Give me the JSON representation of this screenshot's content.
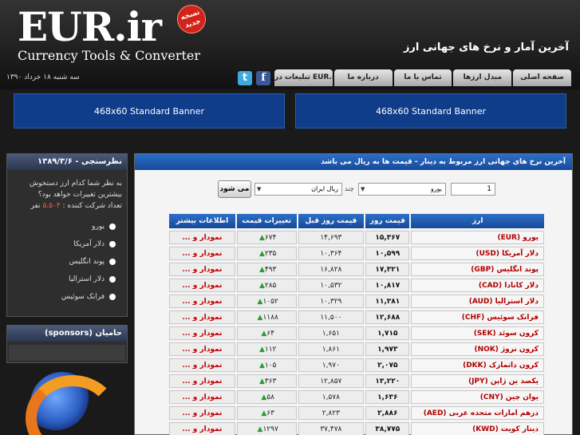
{
  "header": {
    "logo": "EUR.ir",
    "badge": "نسخه جدید",
    "tagline": "Currency Tools & Converter",
    "title": "آخرین آمار و نرخ های جهانی ارز",
    "date": "سه شنبه ۱۸ خرداد ۱۳۹۰"
  },
  "nav": [
    {
      "label": "صفحه اصلی"
    },
    {
      "label": "مبدل ارزها"
    },
    {
      "label": "تماس با ما"
    },
    {
      "label": "درباره ما"
    },
    {
      "label": "تبلیغات در EUR.ir"
    }
  ],
  "banners": {
    "left": "468x60 Standard Banner",
    "right": "468x60 Standard Banner"
  },
  "poll": {
    "title": "نظرسنجی - ۱۳۸۹/۳/۶",
    "question": "به نظر شما کدام ارز دستخوش بیشترین تغییرات خواهد بود؟",
    "participants_label": "تعداد شرکت کننده :",
    "participants_count": "۵.۵۰۳",
    "participants_unit": "نفر",
    "options": [
      {
        "label": "یورو"
      },
      {
        "label": "دلار آمریکا"
      },
      {
        "label": "پوند انگلیس"
      },
      {
        "label": "دلار استرالیا"
      },
      {
        "label": "فرانک سوئیس"
      }
    ]
  },
  "sponsors": {
    "title": "حامیان (sponsors)"
  },
  "main": {
    "header": "آخرین نرخ های جهانی ارز مربوط به دینار - قیمت ها به ریال می باشد",
    "converter": {
      "amount": "1",
      "from": "یورو",
      "chand": "چند",
      "to": "ریال ایران",
      "submit": "می شود"
    },
    "table": {
      "headers": [
        "ارز",
        "قیمت روز",
        "قیمت روز قبل",
        "تغییرات قیمت",
        "اطلاعات بیشتر"
      ],
      "rows": [
        {
          "name": "یورو (EUR)",
          "today": "۱۵,۳۶۷",
          "prev": "۱۴,۶۹۳",
          "change": "۶۷۴",
          "more": "نمودار و ..."
        },
        {
          "name": "دلار آمریکا (USD)",
          "today": "۱۰,۵۹۹",
          "prev": "۱۰,۳۶۴",
          "change": "۲۳۵",
          "more": "نمودار و ..."
        },
        {
          "name": "پوند انگلیس (GBP)",
          "today": "۱۷,۳۲۱",
          "prev": "۱۶,۸۲۸",
          "change": "۴۹۳",
          "more": "نمودار و ..."
        },
        {
          "name": "دلار کانادا (CAD)",
          "today": "۱۰,۸۱۷",
          "prev": "۱۰,۵۳۲",
          "change": "۲۸۵",
          "more": "نمودار و ..."
        },
        {
          "name": "دلار استرالیا (AUD)",
          "today": "۱۱,۳۸۱",
          "prev": "۱۰,۳۲۹",
          "change": "۱۰۵۲",
          "more": "نمودار و ..."
        },
        {
          "name": "فرانک سوئیس (CHF)",
          "today": "۱۲,۶۸۸",
          "prev": "۱۱,۵۰۰",
          "change": "۱۱۸۸",
          "more": "نمودار و ..."
        },
        {
          "name": "کرون سوئد (SEK)",
          "today": "۱,۷۱۵",
          "prev": "۱,۶۵۱",
          "change": "۶۴",
          "more": "نمودار و ..."
        },
        {
          "name": "کرون نروژ (NOK)",
          "today": "۱,۹۷۳",
          "prev": "۱,۸۶۱",
          "change": "۱۱۲",
          "more": "نمودار و ..."
        },
        {
          "name": "کرون دانمارک (DKK)",
          "today": "۲,۰۷۵",
          "prev": "۱,۹۷۰",
          "change": "۱۰۵",
          "more": "نمودار و ..."
        },
        {
          "name": "یکصد ین ژاپن (JPY)",
          "today": "۱۳,۲۲۰",
          "prev": "۱۲,۸۵۷",
          "change": "۳۶۳",
          "more": "نمودار و ..."
        },
        {
          "name": "یوان چین (CNY)",
          "today": "۱,۶۳۶",
          "prev": "۱,۵۷۸",
          "change": "۵۸",
          "more": "نمودار و ..."
        },
        {
          "name": "درهم امارات متحده عربی (AED)",
          "today": "۲,۸۸۶",
          "prev": "۲,۸۲۳",
          "change": "۶۳",
          "more": "نمودار و ..."
        },
        {
          "name": "دینار کویت (KWD)",
          "today": "۳۸,۷۷۵",
          "prev": "۳۷,۴۷۸",
          "change": "۱۲۹۷",
          "more": "نمودار و ..."
        }
      ]
    }
  }
}
